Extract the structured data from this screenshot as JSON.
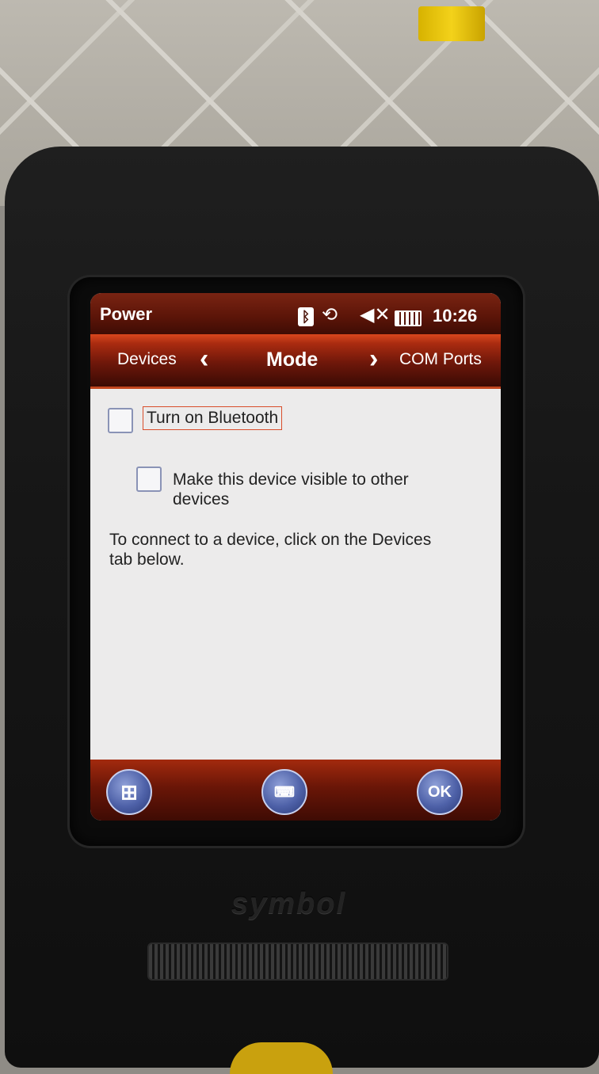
{
  "window": {
    "title": "Power"
  },
  "status": {
    "bluetooth_icon": "bluetooth-icon",
    "connectivity_icon": "sync-icon",
    "volume_icon": "speaker-muted-icon",
    "battery_icon": "battery-icon",
    "time": "10:26"
  },
  "tabs": {
    "previous": "Devices",
    "current": "Mode",
    "next": "COM Ports"
  },
  "options": {
    "bluetooth": {
      "label": "Turn on Bluetooth",
      "checked": false
    },
    "visible": {
      "label": "Make this device visible to other devices",
      "checked": false
    }
  },
  "hint": "To connect to a device, click on the Devices tab below.",
  "softkeys": {
    "start_icon": "windows-start-icon",
    "keyboard_icon": "keyboard-icon",
    "ok": "OK"
  },
  "device": {
    "brand": "symbol"
  },
  "colors": {
    "title_bar": "#5a1408",
    "tab_bar": "#a92b10",
    "softkey": "#4e61a8",
    "content_bg": "#ecebeb"
  }
}
